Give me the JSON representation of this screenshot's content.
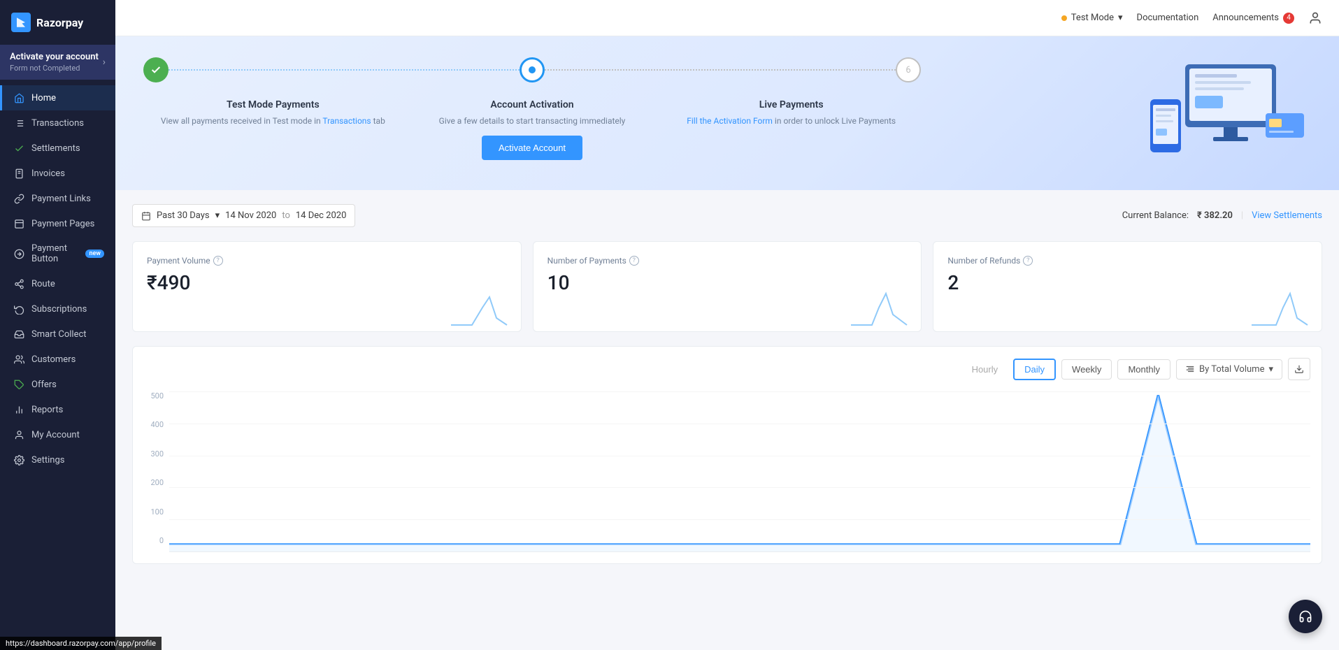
{
  "brand": {
    "name": "Razorpay",
    "logo_char": "R"
  },
  "sidebar": {
    "activate_title": "Activate your account",
    "activate_sub": "Form not Completed",
    "items": [
      {
        "id": "home",
        "label": "Home",
        "icon": "home",
        "active": true
      },
      {
        "id": "transactions",
        "label": "Transactions",
        "icon": "list"
      },
      {
        "id": "settlements",
        "label": "Settlements",
        "icon": "check-circle"
      },
      {
        "id": "invoices",
        "label": "Invoices",
        "icon": "file-text"
      },
      {
        "id": "payment-links",
        "label": "Payment Links",
        "icon": "link"
      },
      {
        "id": "payment-pages",
        "label": "Payment Pages",
        "icon": "layout"
      },
      {
        "id": "payment-button",
        "label": "Payment Button",
        "icon": "arrow-right-circle",
        "badge": "new"
      },
      {
        "id": "route",
        "label": "Route",
        "icon": "share-2"
      },
      {
        "id": "subscriptions",
        "label": "Subscriptions",
        "icon": "refresh-cw"
      },
      {
        "id": "smart-collect",
        "label": "Smart Collect",
        "icon": "inbox"
      },
      {
        "id": "customers",
        "label": "Customers",
        "icon": "users"
      },
      {
        "id": "offers",
        "label": "Offers",
        "icon": "tag"
      },
      {
        "id": "reports",
        "label": "Reports",
        "icon": "bar-chart-2"
      },
      {
        "id": "my-account",
        "label": "My Account",
        "icon": "user"
      },
      {
        "id": "settings",
        "label": "Settings",
        "icon": "settings"
      }
    ]
  },
  "topbar": {
    "test_mode_label": "Test Mode",
    "documentation_label": "Documentation",
    "announcements_label": "Announcements",
    "announcements_count": "4"
  },
  "activation": {
    "step1_title": "Test Mode Payments",
    "step1_desc": "View all payments received in Test mode in",
    "step1_link": "Transactions",
    "step1_link_suffix": "tab",
    "step2_title": "Account Activation",
    "step2_desc": "Give a few details to start transacting immediately",
    "step2_btn": "Activate Account",
    "step3_title": "Live Payments",
    "step3_desc": "Fill the Activation Form in order to unlock Live Payments",
    "step3_link": "Fill the Activation Form"
  },
  "filter": {
    "period_label": "Past 30 Days",
    "date_from": "14 Nov 2020",
    "date_to": "14 Dec 2020",
    "current_balance_label": "Current Balance:",
    "current_balance_amount": "₹ 382.20",
    "view_settlements": "View Settlements"
  },
  "stats": [
    {
      "title": "Payment Volume",
      "value": "₹490",
      "has_info": true
    },
    {
      "title": "Number of Payments",
      "value": "10",
      "has_info": true
    },
    {
      "title": "Number of Refunds",
      "value": "2",
      "has_info": true
    }
  ],
  "chart": {
    "time_filters": [
      {
        "label": "Hourly",
        "id": "hourly",
        "active": false
      },
      {
        "label": "Daily",
        "id": "daily",
        "active": true
      },
      {
        "label": "Weekly",
        "id": "weekly",
        "active": false
      },
      {
        "label": "Monthly",
        "id": "monthly",
        "active": false
      }
    ],
    "sort_label": "By Total Volume",
    "y_labels": [
      "500",
      "400",
      "300",
      "200",
      "100",
      "0"
    ],
    "data_points": [
      0,
      0,
      0,
      0,
      0,
      0,
      0,
      0,
      0,
      0,
      0,
      0,
      0,
      0,
      0,
      0,
      0,
      0,
      0,
      0,
      0,
      0,
      0,
      0,
      0,
      490,
      0,
      0,
      0,
      0
    ]
  },
  "support": {
    "icon": "headphones"
  },
  "statusbar": {
    "url": "https://dashboard.razorpay.com/app/profile"
  }
}
